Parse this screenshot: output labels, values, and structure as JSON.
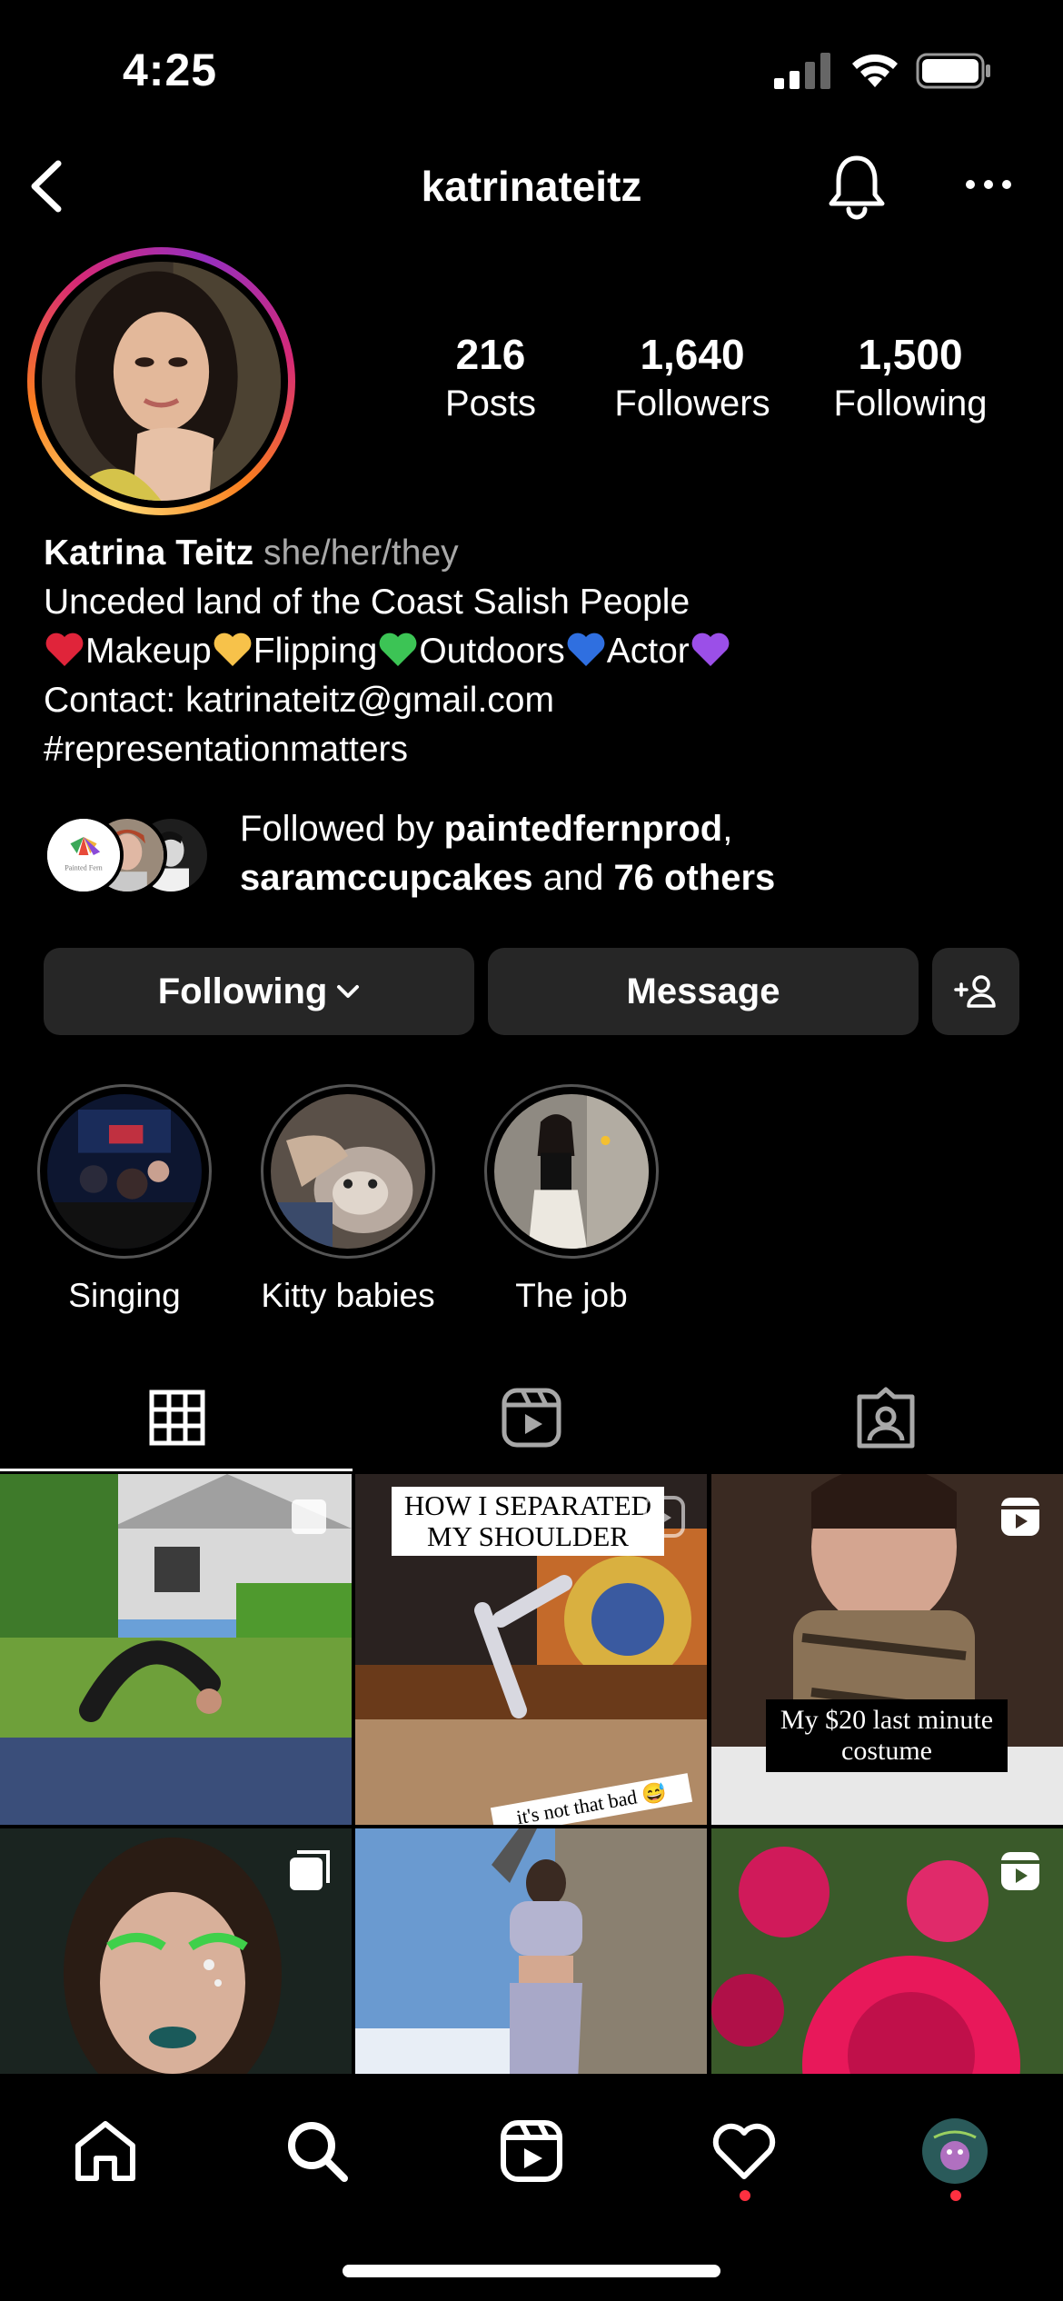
{
  "status_bar": {
    "time": "4:25"
  },
  "header": {
    "username": "katrinateitz"
  },
  "profile": {
    "stats": [
      {
        "value": "216",
        "label": "Posts"
      },
      {
        "value": "1,640",
        "label": "Followers"
      },
      {
        "value": "1,500",
        "label": "Following"
      }
    ],
    "name": "Katrina Teitz",
    "pronouns": "she/her/they",
    "bio_line1": "Unceded land of the Coast Salish People",
    "bio_tags": [
      "Makeup",
      "Flipping",
      "Outdoors",
      "Actor"
    ],
    "bio_heart_colors": [
      "#e0243a",
      "#f7c24a",
      "#3cc455",
      "#2f6fe0",
      "#9b4fe8"
    ],
    "contact": "Contact: katrinateitz@gmail.com",
    "hashtag": "#representationmatters",
    "followed_by_prefix": "Followed by ",
    "followed_by_user1": "paintedfernprod",
    "followed_by_comma": ",",
    "followed_by_user2": "saramccupcakes",
    "followed_by_and": " and ",
    "followed_by_others": "76 others",
    "mini_avatar_logo_text": "Painted Fern"
  },
  "actions": {
    "following_label": "Following",
    "message_label": "Message"
  },
  "highlights": [
    {
      "label": "Singing"
    },
    {
      "label": "Kitty babies"
    },
    {
      "label": "The job"
    }
  ],
  "tabs": [
    "grid-icon",
    "reels-icon",
    "tagged-icon"
  ],
  "grid": {
    "captions": {
      "tile2_top": "HOW I SEPARATED MY SHOULDER",
      "tile2_bottom": "it's not that bad 😅",
      "tile3": "My $20 last minute costume"
    }
  },
  "bottom_nav": [
    "home-icon",
    "search-icon",
    "reels-icon",
    "activity-heart-icon",
    "profile-avatar"
  ],
  "colors": {
    "background": "#000000",
    "button": "#262626",
    "notification_dot": "#ff3040",
    "muted_text": "#a8a8a8"
  }
}
